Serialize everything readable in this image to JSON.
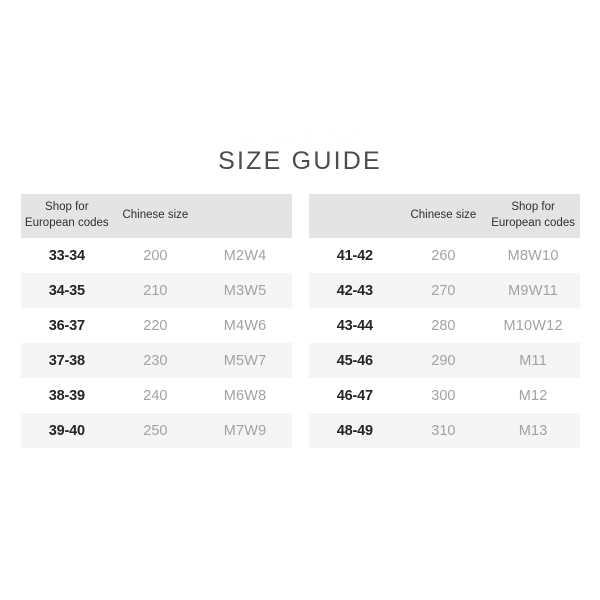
{
  "page": {
    "title": "SIZE GUIDE",
    "watermark": "size guide chart",
    "background_color": "#ffffff",
    "title_color": "#4c4c4c",
    "header_background_color": "#e4e4e4",
    "row_stripe_color": "#f5f5f5",
    "primary_text_color": "#262626",
    "secondary_text_color": "#a2a2a2"
  },
  "tables": [
    {
      "id": "left-table",
      "headers": [
        {
          "lines": [
            "Shop for",
            "European codes"
          ]
        },
        {
          "lines": [
            "Chinese size"
          ]
        },
        {
          "lines": [
            ""
          ]
        }
      ],
      "rows": [
        {
          "european": "33-34",
          "chinese": "200",
          "code": "M2W4"
        },
        {
          "european": "34-35",
          "chinese": "210",
          "code": "M3W5"
        },
        {
          "european": "36-37",
          "chinese": "220",
          "code": "M4W6"
        },
        {
          "european": "37-38",
          "chinese": "230",
          "code": "M5W7"
        },
        {
          "european": "38-39",
          "chinese": "240",
          "code": "M6W8"
        },
        {
          "european": "39-40",
          "chinese": "250",
          "code": "M7W9"
        }
      ]
    },
    {
      "id": "right-table",
      "headers": [
        {
          "lines": [
            ""
          ]
        },
        {
          "lines": [
            "Chinese size"
          ]
        },
        {
          "lines": [
            "Shop for",
            "European codes"
          ]
        }
      ],
      "rows": [
        {
          "european": "41-42",
          "chinese": "260",
          "code": "M8W10"
        },
        {
          "european": "42-43",
          "chinese": "270",
          "code": "M9W11"
        },
        {
          "european": "43-44",
          "chinese": "280",
          "code": "M10W12"
        },
        {
          "european": "45-46",
          "chinese": "290",
          "code": "M11"
        },
        {
          "european": "46-47",
          "chinese": "300",
          "code": "M12"
        },
        {
          "european": "48-49",
          "chinese": "310",
          "code": "M13"
        }
      ]
    }
  ]
}
